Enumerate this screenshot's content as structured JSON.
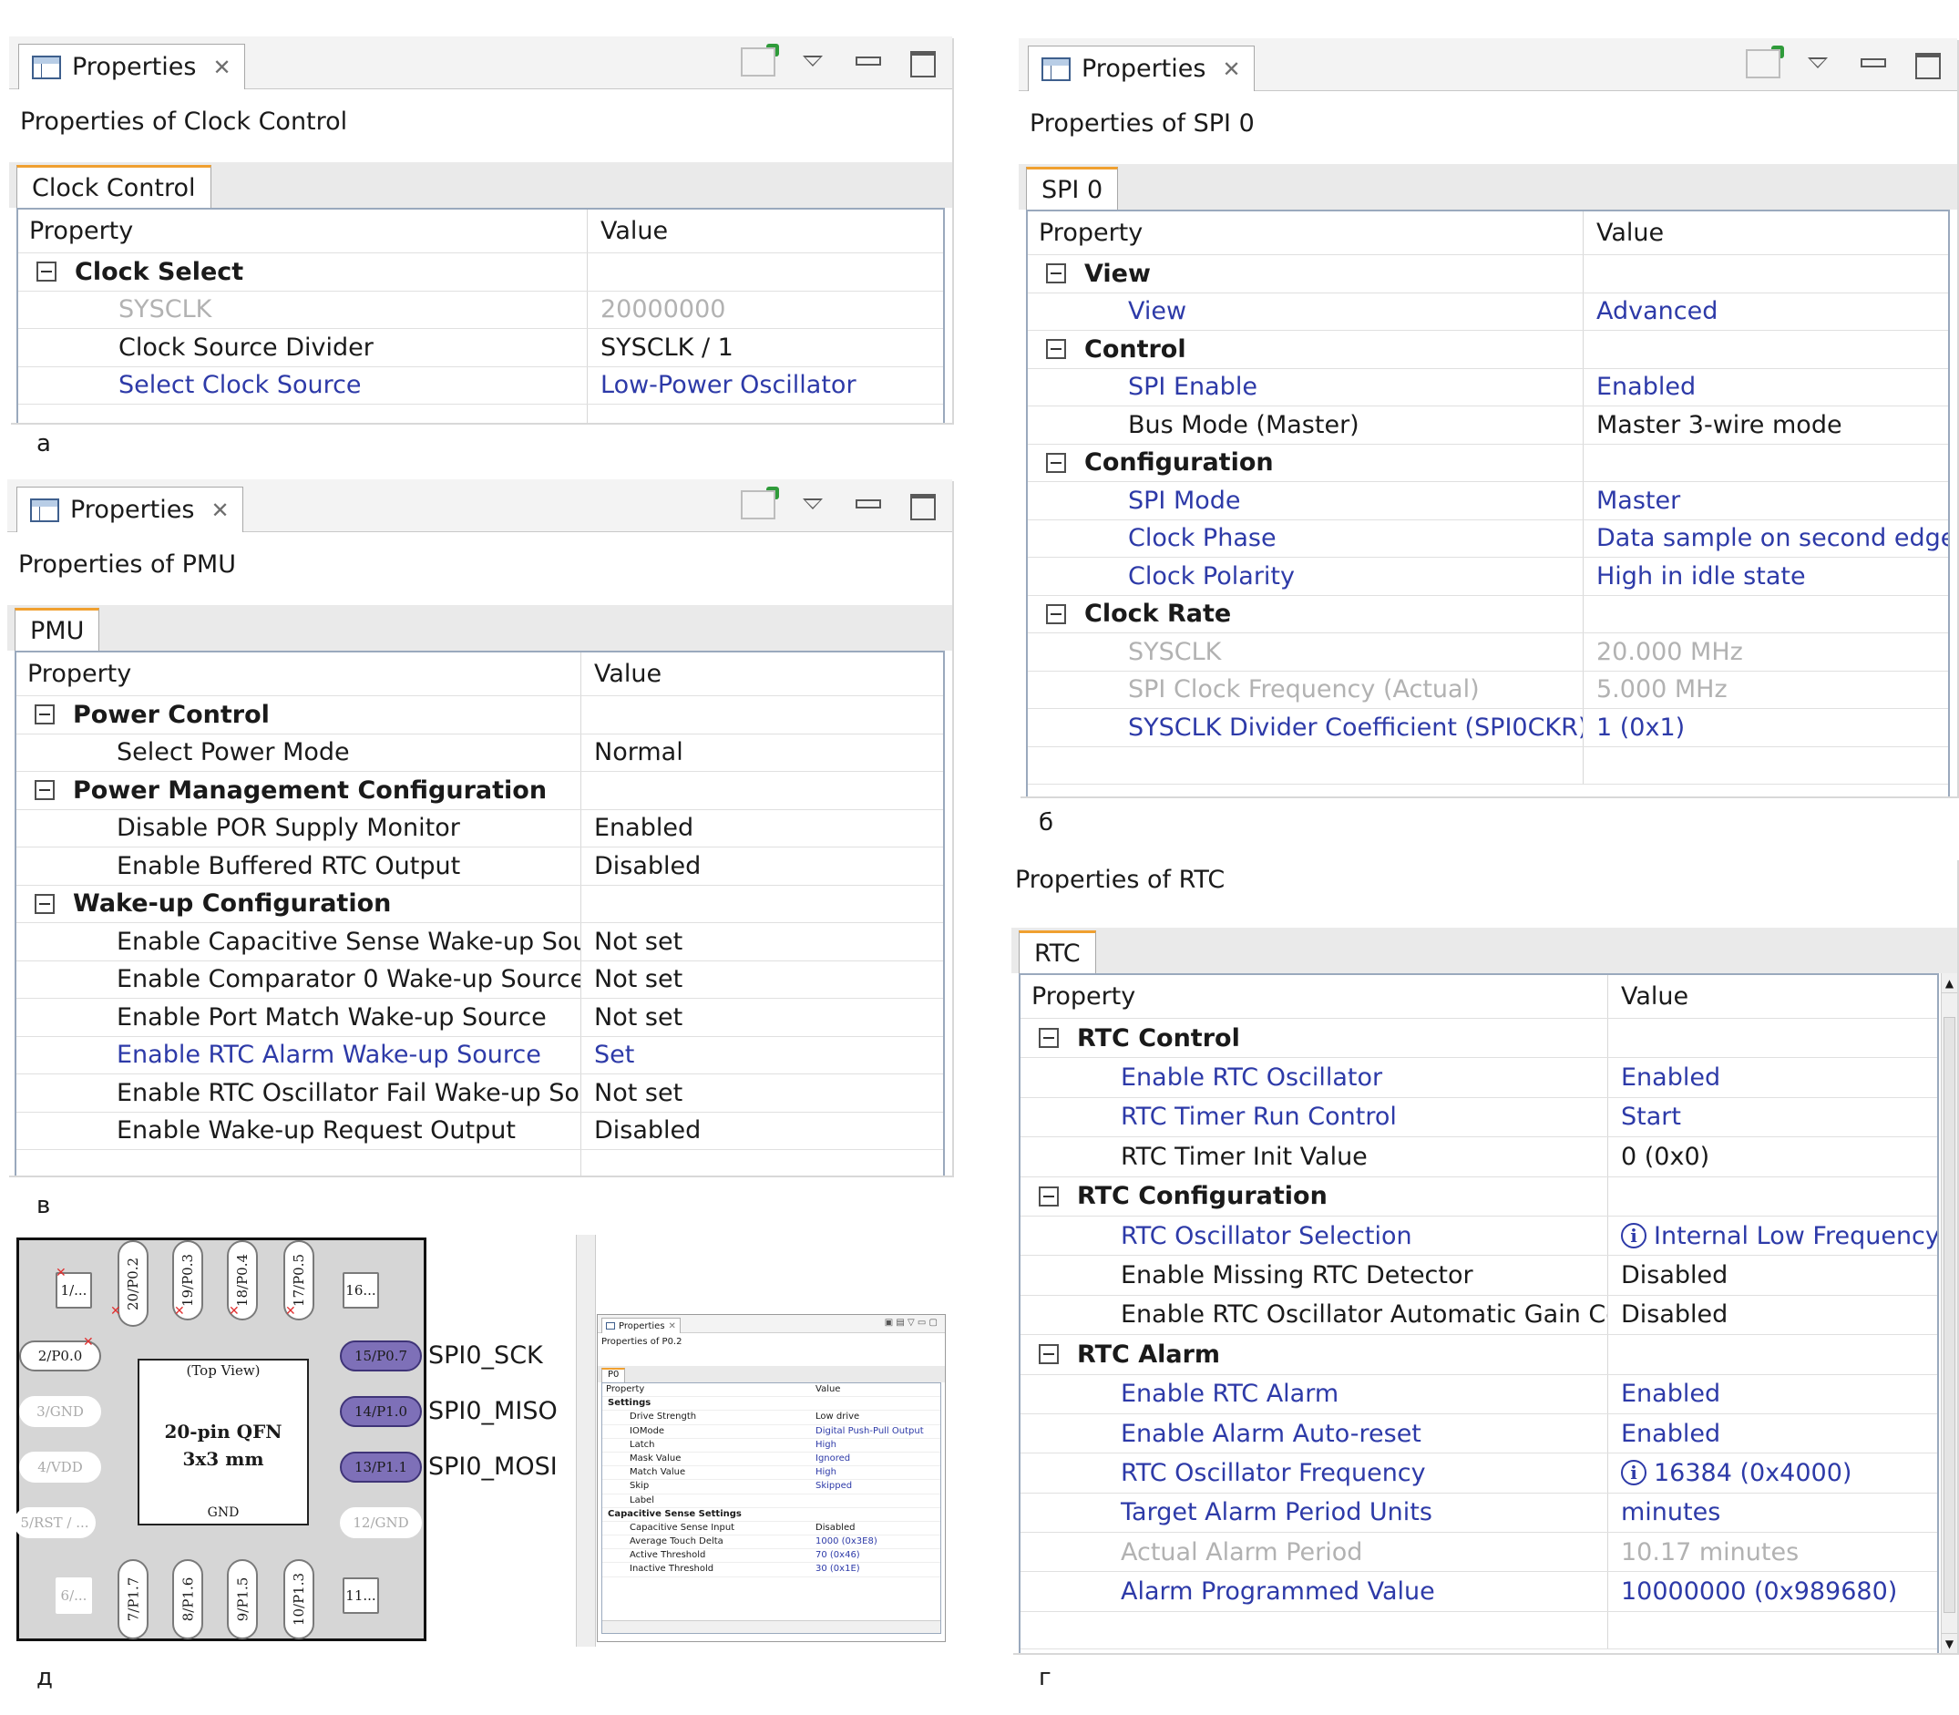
{
  "common": {
    "view_title": "Properties",
    "col_property": "Property",
    "col_value": "Value"
  },
  "labels": {
    "a": "а",
    "b": "б",
    "v": "в",
    "g": "г",
    "d": "д"
  },
  "clock_control": {
    "subtitle": "Properties of Clock Control",
    "tab": "Clock Control",
    "categories": [
      {
        "name": "Clock Select",
        "items": [
          {
            "property": "SYSCLK",
            "value": "20000000",
            "state": "readonly"
          },
          {
            "property": "Clock Source Divider",
            "value": "SYSCLK / 1",
            "state": "default"
          },
          {
            "property": "Select Clock Source",
            "value": "Low-Power Oscillator",
            "state": "modified"
          }
        ]
      }
    ]
  },
  "pmu": {
    "subtitle": "Properties of PMU",
    "tab": "PMU",
    "categories": [
      {
        "name": "Power Control",
        "items": [
          {
            "property": "Select Power Mode",
            "value": "Normal",
            "state": "default"
          }
        ]
      },
      {
        "name": "Power Management Configuration",
        "items": [
          {
            "property": "Disable POR Supply Monitor",
            "value": "Enabled",
            "state": "default"
          },
          {
            "property": "Enable Buffered RTC Output",
            "value": "Disabled",
            "state": "default"
          }
        ]
      },
      {
        "name": "Wake-up Configuration",
        "items": [
          {
            "property": "Enable Capacitive Sense Wake-up Sourc",
            "value": "Not set",
            "state": "default"
          },
          {
            "property": "Enable Comparator 0 Wake-up Source",
            "value": "Not set",
            "state": "default"
          },
          {
            "property": "Enable Port Match Wake-up Source",
            "value": "Not set",
            "state": "default"
          },
          {
            "property": "Enable RTC Alarm Wake-up Source",
            "value": "Set",
            "state": "modified"
          },
          {
            "property": "Enable RTC Oscillator Fail Wake-up Sour",
            "value": "Not set",
            "state": "default"
          },
          {
            "property": "Enable Wake-up Request Output",
            "value": "Disabled",
            "state": "default"
          }
        ]
      }
    ]
  },
  "spi0": {
    "subtitle": "Properties of SPI 0",
    "tab": "SPI 0",
    "categories": [
      {
        "name": "View",
        "items": [
          {
            "property": "View",
            "value": "Advanced",
            "state": "modified"
          }
        ]
      },
      {
        "name": "Control",
        "items": [
          {
            "property": "SPI Enable",
            "value": "Enabled",
            "state": "modified"
          },
          {
            "property": "Bus Mode (Master)",
            "value": "Master 3-wire mode",
            "state": "default"
          }
        ]
      },
      {
        "name": "Configuration",
        "items": [
          {
            "property": "SPI Mode",
            "value": "Master",
            "state": "modified"
          },
          {
            "property": "Clock Phase",
            "value": "Data sample on second edge",
            "state": "modified"
          },
          {
            "property": "Clock Polarity",
            "value": "High in idle state",
            "state": "modified"
          }
        ]
      },
      {
        "name": "Clock Rate",
        "items": [
          {
            "property": "SYSCLK",
            "value": "20.000 MHz",
            "state": "readonly"
          },
          {
            "property": "SPI Clock Frequency (Actual)",
            "value": "5.000 MHz",
            "state": "readonly"
          },
          {
            "property": "SYSCLK Divider Coefficient (SPI0CKR)",
            "value": "1 (0x1)",
            "state": "modified"
          }
        ]
      }
    ]
  },
  "rtc": {
    "subtitle": "Properties of RTC",
    "tab": "RTC",
    "categories": [
      {
        "name": "RTC Control",
        "items": [
          {
            "property": "Enable RTC Oscillator",
            "value": "Enabled",
            "state": "modified"
          },
          {
            "property": "RTC Timer Run Control",
            "value": "Start",
            "state": "modified"
          },
          {
            "property": "RTC Timer Init Value",
            "value": "0 (0x0)",
            "state": "default"
          }
        ]
      },
      {
        "name": "RTC Configuration",
        "items": [
          {
            "property": "RTC Oscillator Selection",
            "value": "Internal Low Frequency",
            "state": "modified",
            "info": true
          },
          {
            "property": "Enable Missing RTC Detector",
            "value": "Disabled",
            "state": "default"
          },
          {
            "property": "Enable RTC Oscillator Automatic Gain Co",
            "value": "Disabled",
            "state": "default"
          }
        ]
      },
      {
        "name": "RTC Alarm",
        "items": [
          {
            "property": "Enable RTC Alarm",
            "value": "Enabled",
            "state": "modified"
          },
          {
            "property": "Enable Alarm Auto-reset",
            "value": "Enabled",
            "state": "modified"
          },
          {
            "property": "RTC Oscillator Frequency",
            "value": "16384 (0x4000)",
            "state": "modified",
            "info": true
          },
          {
            "property": "Target Alarm Period Units",
            "value": "minutes",
            "state": "modified"
          },
          {
            "property": "Actual Alarm Period",
            "value": "10.17 minutes",
            "state": "readonly"
          },
          {
            "property": "Alarm Programmed Value",
            "value": "10000000 (0x989680)",
            "state": "modified"
          }
        ]
      }
    ]
  },
  "chip": {
    "top_view": "(Top View)",
    "package_line1": "20-pin QFN",
    "package_line2": "3x3 mm",
    "gnd_label": "GND",
    "pins_left": [
      "2/P0.0",
      "3/GND",
      "4/VDD",
      "5/RST / ..."
    ],
    "pins_right": [
      "15/P0.7",
      "14/P1.0",
      "13/P1.1",
      "12/GND"
    ],
    "pins_top": [
      "20/P0.2",
      "19/P0.3",
      "18/P0.4",
      "17/P0.5"
    ],
    "pins_bottom": [
      "7/P1.7",
      "8/P1.6",
      "9/P1.5",
      "10/P1.3"
    ],
    "corners": [
      "1/...",
      "16...",
      "6/...",
      "11..."
    ],
    "signals": [
      "SPI0_SCK",
      "SPI0_MISO",
      "SPI0_MOSI"
    ]
  },
  "mini_props": {
    "title": "Properties",
    "subtitle": "Properties of P0.2",
    "tab": "P0",
    "col_property": "Property",
    "col_value": "Value",
    "rows": [
      {
        "p": "Settings",
        "v": "",
        "cat": true
      },
      {
        "p": "Drive Strength",
        "v": "Low drive"
      },
      {
        "p": "IOMode",
        "v": "Digital Push-Pull Output"
      },
      {
        "p": "Latch",
        "v": "High"
      },
      {
        "p": "Mask Value",
        "v": "Ignored"
      },
      {
        "p": "Match Value",
        "v": "High"
      },
      {
        "p": "Skip",
        "v": "Skipped"
      },
      {
        "p": "Label",
        "v": ""
      },
      {
        "p": "Capacitive Sense Settings",
        "v": "",
        "cat": true
      },
      {
        "p": "Capacitive Sense Input",
        "v": "Disabled"
      },
      {
        "p": "Average Touch Delta",
        "v": "1000 (0x3E8)"
      },
      {
        "p": "Active Threshold",
        "v": "70 (0x46)"
      },
      {
        "p": "Inactive Threshold",
        "v": "30 (0x1E)"
      }
    ]
  }
}
